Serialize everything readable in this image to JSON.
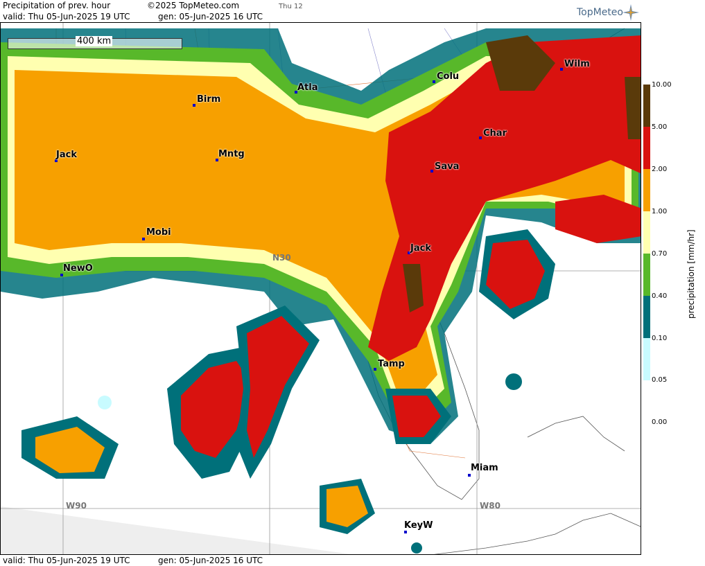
{
  "header": {
    "title": "Precipitation of prev. hour",
    "copyright": "©2025 TopMeteo.com",
    "valid": "valid:  Thu  05-Jun-2025  19 UTC",
    "gen": "gen: 05-Jun-2025 16 UTC",
    "day": "Thu 12"
  },
  "footer": {
    "valid": "valid:  Thu  05-Jun-2025  19 UTC",
    "gen": "gen: 05-Jun-2025 16 UTC"
  },
  "logo": "TopMeteo",
  "scale": "400 km",
  "colorbar": {
    "unit": "precipitation  [mm/hr]",
    "ticks": [
      "10.00",
      "5.00",
      "2.00",
      "1.00",
      "0.70",
      "0.40",
      "0.10",
      "0.05",
      "0.00"
    ],
    "colors": [
      "#5a3a0a",
      "#d9120f",
      "#f7a000",
      "#ffffb0",
      "#58b82a",
      "#00707a",
      "#c8fbff"
    ]
  },
  "cities": [
    {
      "name": "Birm"
    },
    {
      "name": "Atla"
    },
    {
      "name": "Colu"
    },
    {
      "name": "Wilm"
    },
    {
      "name": "Char"
    },
    {
      "name": "Sava"
    },
    {
      "name": "Jack"
    },
    {
      "name": "Mntg"
    },
    {
      "name": "Mobi"
    },
    {
      "name": "NewO"
    },
    {
      "name": "Jack"
    },
    {
      "name": "Tamp"
    },
    {
      "name": "Miam"
    },
    {
      "name": "KeyW"
    }
  ],
  "grid_labels": {
    "n30": "N30",
    "w90": "W90",
    "w80": "W80"
  }
}
